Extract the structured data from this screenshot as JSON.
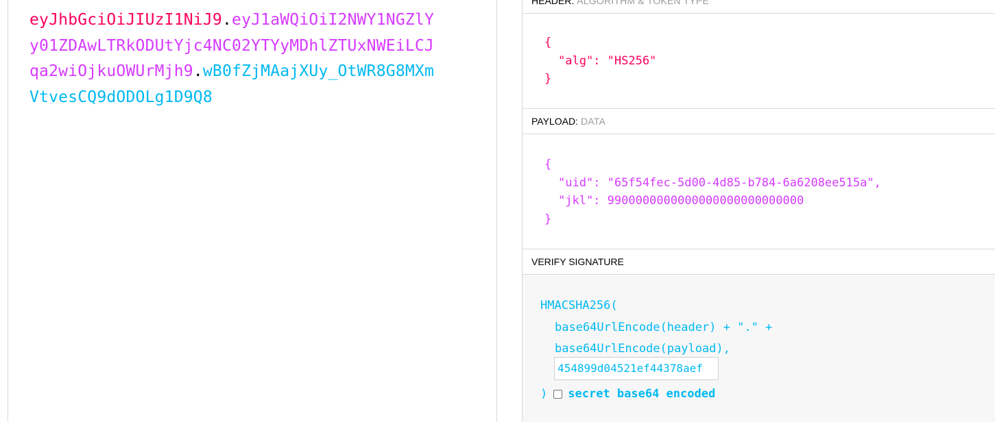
{
  "encoded": {
    "header": "eyJhbGciOiJIUzI1NiJ9",
    "payload": "eyJ1aWQiOiI2NWY1NGZlYy01ZDAwLTRkODUtYjc4NC02YTYyMDhlZTUxNWEiLCJqa2wiOjkuOWUrMjh9",
    "signature": "wB0fZjMAajXUy_OtWR8G8MXmVtvesCQ9dODOLg1D9Q8",
    "dot": "."
  },
  "decoded": {
    "header_section": {
      "title": "HEADER:",
      "subtitle": "ALGORITHM & TOKEN TYPE"
    },
    "header_json": {
      "open": "{",
      "line1": "\"alg\": \"HS256\"",
      "close": "}"
    },
    "payload_section": {
      "title": "PAYLOAD:",
      "subtitle": "DATA"
    },
    "payload_json": {
      "open": "{",
      "line1": "\"uid\": \"65f54fec-5d00-4d85-b784-6a6208ee515a\",",
      "line2": "\"jkl\": 9900000000000000000000000000",
      "close": "}"
    },
    "verify_section": {
      "title": "VERIFY SIGNATURE"
    },
    "verify": {
      "fn_open": "HMACSHA256(",
      "line1": "base64UrlEncode(header) + \".\" +",
      "line2": "base64UrlEncode(payload),",
      "secret_value": "454899d04521ef44378aef",
      "fn_close": ")",
      "secret_encoded_label": "secret base64 encoded"
    }
  },
  "colors": {
    "header": "#fb015b",
    "payload": "#d63aff",
    "signature": "#00b9f1"
  }
}
